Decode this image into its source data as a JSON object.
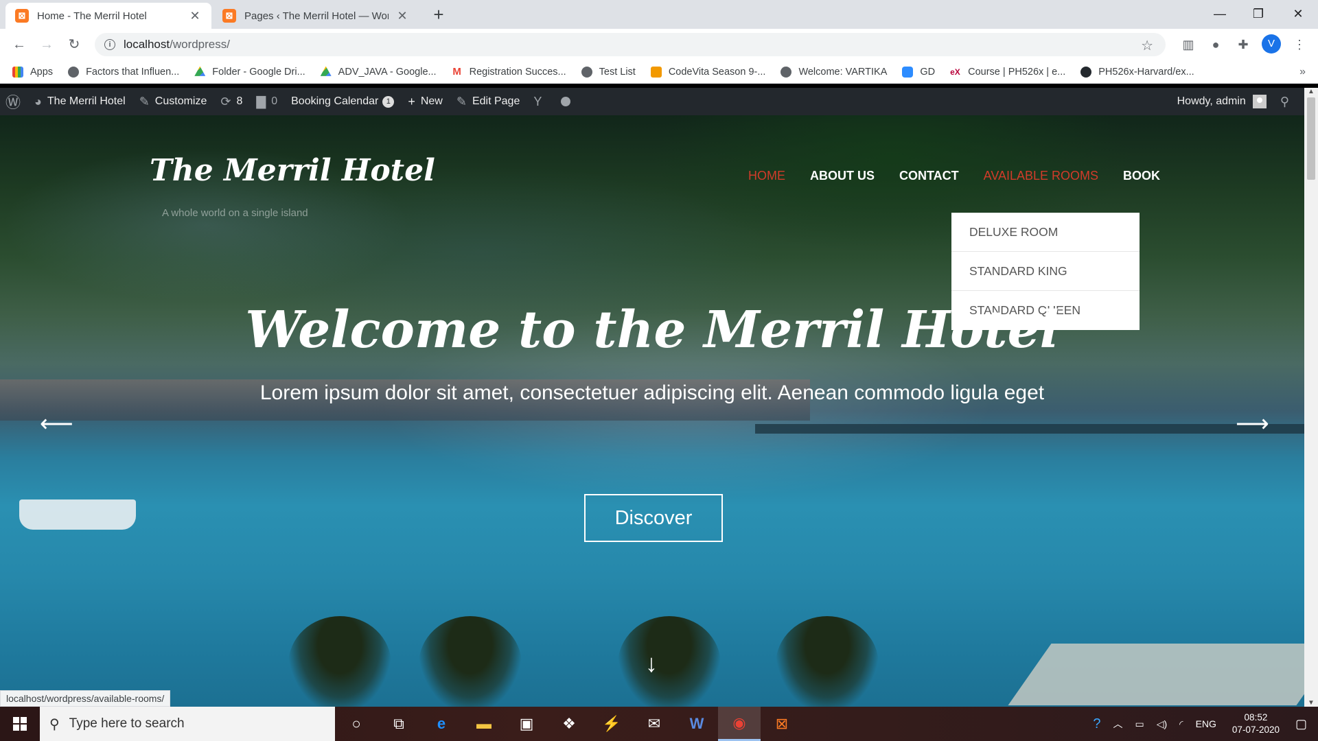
{
  "browser": {
    "tabs": [
      {
        "title": "Home - The Merril Hotel",
        "active": true
      },
      {
        "title": "Pages ‹ The Merril Hotel — WordPress",
        "active": false
      }
    ],
    "url_host": "localhost",
    "url_path": "/wordpress/",
    "profile_initial": "V",
    "bookmarks": [
      {
        "label": "Apps",
        "icon": "apps-grid-icon",
        "color": "#e94235"
      },
      {
        "label": "Factors that Influen...",
        "icon": "globe-icon",
        "color": "#5f6368"
      },
      {
        "label": "Folder - Google Dri...",
        "icon": "drive-icon",
        "color": "#fbbc04"
      },
      {
        "label": "ADV_JAVA - Google...",
        "icon": "drive-icon",
        "color": "#34a853"
      },
      {
        "label": "Registration Succes...",
        "icon": "gmail-icon",
        "color": "#ea4335"
      },
      {
        "label": "Test List",
        "icon": "globe-icon",
        "color": "#5f6368"
      },
      {
        "label": "CodeVita Season 9-...",
        "icon": "tcs-icon",
        "color": "#f29900"
      },
      {
        "label": "Welcome: VARTIKA",
        "icon": "globe-icon",
        "color": "#5f6368"
      },
      {
        "label": "GD",
        "icon": "zoom-icon",
        "color": "#2d8cff"
      },
      {
        "label": "Course | PH526x | e...",
        "icon": "edx-icon",
        "color": "#b8003a"
      },
      {
        "label": "PH526x-Harvard/ex...",
        "icon": "github-icon",
        "color": "#24292e"
      }
    ],
    "status_url": "localhost/wordpress/available-rooms/"
  },
  "adminbar": {
    "site_name": "The Merril Hotel",
    "customize": "Customize",
    "updates_count": "8",
    "comments_count": "0",
    "booking_calendar": "Booking Calendar",
    "booking_badge": "1",
    "new": "New",
    "edit_page": "Edit Page",
    "howdy": "Howdy, admin"
  },
  "site": {
    "title": "The Merril Hotel",
    "tagline": "A whole world on a single island",
    "menu": {
      "home": "HOME",
      "about": "ABOUT US",
      "contact": "CONTACT",
      "rooms": "AVAILABLE ROOMS",
      "book": "BOOK"
    },
    "dropdown": [
      "DELUXE ROOM",
      "STANDARD KING",
      "STANDARD QUEEN"
    ],
    "hero_heading": "Welcome to the Merril Hotel",
    "hero_text": "Lorem ipsum dolor sit amet, consectetuer adipiscing elit. Aenean commodo ligula eget",
    "discover": "Discover"
  },
  "taskbar": {
    "search_placeholder": "Type here to search",
    "language": "ENG",
    "time": "08:52",
    "date": "07-07-2020"
  },
  "colors": {
    "accent_red": "#d13b2a",
    "wp_adminbar": "#23282d",
    "xampp_orange": "#fb7a24"
  }
}
